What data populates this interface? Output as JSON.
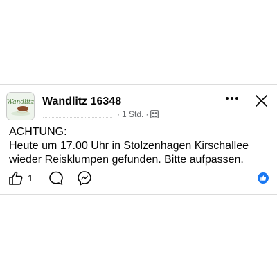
{
  "post": {
    "group_name": "Wandlitz 16348",
    "time": "1 Std.",
    "separator": "·",
    "text": "ACHTUNG:\nHeute um 17.00 Uhr in Stolzenhagen Kirschallee wieder Reisklumpen gefunden. Bitte aufpassen.",
    "like_count": "1",
    "avatar_logo_text": "Wandlitz",
    "privacy": "group-privacy-icon"
  },
  "icons": {
    "more": "more-dots-icon",
    "close": "close-icon",
    "like": "thumbs-up-icon",
    "comment": "comment-bubble-icon",
    "share": "messenger-icon",
    "reaction": "like-reaction-icon"
  },
  "colors": {
    "text": "#050505",
    "secondary": "#65676b",
    "accent": "#1877f2"
  }
}
